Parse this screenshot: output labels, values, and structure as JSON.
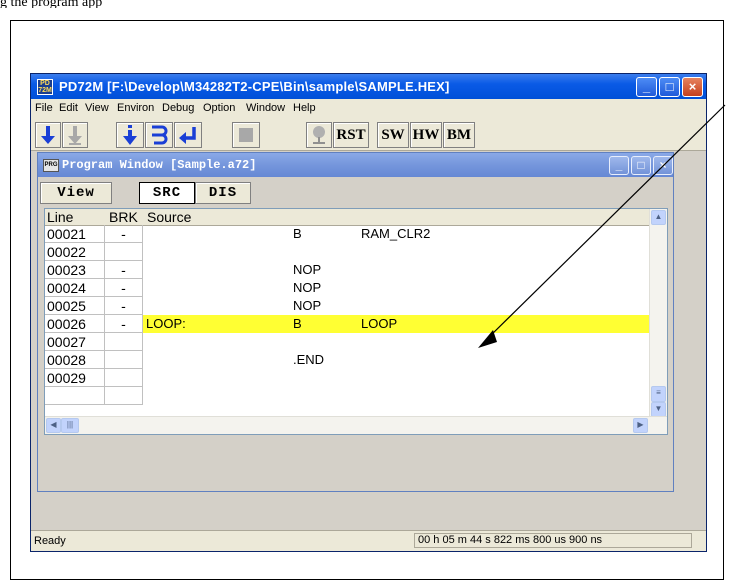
{
  "doc_text_cut": "g the                                     program        app",
  "app": {
    "title": "PD72M [F:\\Develop\\M34282T2-CPE\\Bin\\sample\\SAMPLE.HEX]",
    "icon_text": "PD 72M",
    "buttons": {
      "minimize": "_",
      "maximize": "□",
      "close": "×"
    }
  },
  "menu": [
    "File",
    "Edit",
    "View",
    "Environ",
    "Debug",
    "Option",
    "Window",
    "Help"
  ],
  "toolbar": {
    "rst": "RST",
    "sw": "SW",
    "hw": "HW",
    "bm": "BM"
  },
  "program_window": {
    "title": "Program Window [Sample.a72]",
    "icon_text": "PRG",
    "tabs": {
      "view": "View",
      "src": "SRC",
      "dis": "DIS"
    },
    "headers": {
      "line": "Line",
      "brk": "BRK",
      "source": "Source"
    },
    "rows": [
      {
        "line": "00021",
        "brk": "-",
        "label": "",
        "op": "B",
        "arg": "RAM_CLR2",
        "highlight": false
      },
      {
        "line": "00022",
        "brk": "",
        "label": "",
        "op": "",
        "arg": "",
        "highlight": false
      },
      {
        "line": "00023",
        "brk": "-",
        "label": "",
        "op": "NOP",
        "arg": "",
        "highlight": false
      },
      {
        "line": "00024",
        "brk": "-",
        "label": "",
        "op": "NOP",
        "arg": "",
        "highlight": false
      },
      {
        "line": "00025",
        "brk": "-",
        "label": "",
        "op": "NOP",
        "arg": "",
        "highlight": false
      },
      {
        "line": "00026",
        "brk": "-",
        "label": "LOOP:",
        "op": "B",
        "arg": "LOOP",
        "highlight": true
      },
      {
        "line": "00027",
        "brk": "",
        "label": "",
        "op": "",
        "arg": "",
        "highlight": false
      },
      {
        "line": "00028",
        "brk": "",
        "label": "",
        "op": ".END",
        "arg": "",
        "highlight": false
      },
      {
        "line": "00029",
        "brk": "",
        "label": "",
        "op": "",
        "arg": "",
        "highlight": false
      },
      {
        "line": "",
        "brk": "",
        "label": "",
        "op": "",
        "arg": "",
        "highlight": false
      }
    ]
  },
  "status": {
    "ready": "Ready",
    "time": "00 h 05 m 44 s 822 ms 800 us 900 ns"
  },
  "colors": {
    "highlight": "#ffff33",
    "titlebar": "#0050d8",
    "program_titlebar": "#7596dc",
    "arrow": "#000000"
  }
}
